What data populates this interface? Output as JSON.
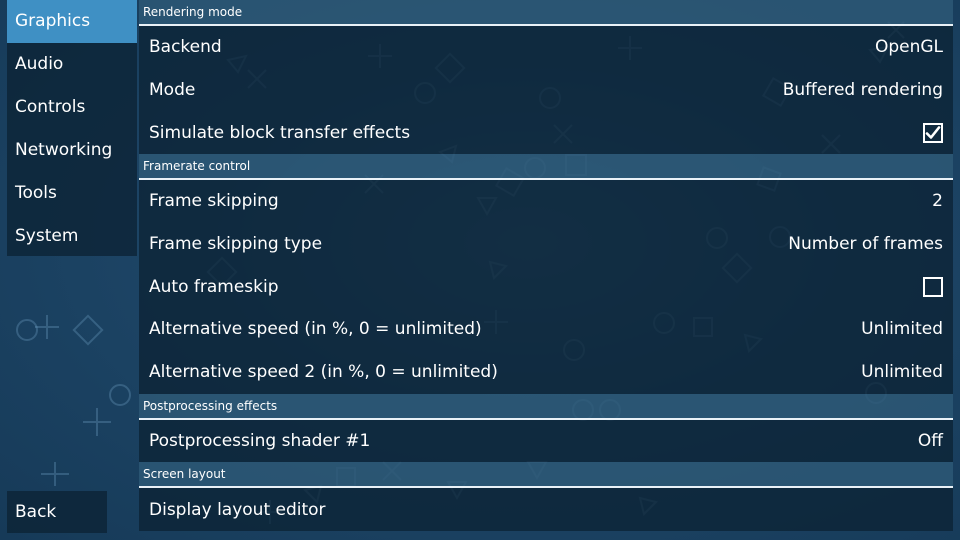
{
  "tabs": {
    "items": [
      {
        "label": "Graphics"
      },
      {
        "label": "Audio"
      },
      {
        "label": "Controls"
      },
      {
        "label": "Networking"
      },
      {
        "label": "Tools"
      },
      {
        "label": "System"
      }
    ],
    "active": "Graphics",
    "back_label": "Back"
  },
  "sections": {
    "rendering_mode": {
      "header": "Rendering mode",
      "backend": {
        "label": "Backend",
        "value": "OpenGL"
      },
      "mode": {
        "label": "Mode",
        "value": "Buffered rendering"
      },
      "block_transfer": {
        "label": "Simulate block transfer effects",
        "checked": true
      }
    },
    "framerate_control": {
      "header": "Framerate control",
      "frame_skipping": {
        "label": "Frame skipping",
        "value": "2"
      },
      "frame_skipping_type": {
        "label": "Frame skipping type",
        "value": "Number of frames"
      },
      "auto_frameskip": {
        "label": "Auto frameskip",
        "checked": false
      },
      "alt_speed": {
        "label": "Alternative speed (in %, 0 = unlimited)",
        "value": "Unlimited"
      },
      "alt_speed_2": {
        "label": "Alternative speed 2 (in %, 0 = unlimited)",
        "value": "Unlimited"
      }
    },
    "postprocessing": {
      "header": "Postprocessing effects",
      "shader1": {
        "label": "Postprocessing shader #1",
        "value": "Off"
      }
    },
    "screen_layout": {
      "header": "Screen layout",
      "layout_editor": {
        "label": "Display layout editor"
      }
    }
  },
  "colors": {
    "active_tab": "#3f90c4",
    "panel_bg": "#0c2234",
    "header_bg": "#2d5876",
    "background": "#1d4566"
  },
  "icons": {
    "checked": "checkmark-icon",
    "background_pattern": "playstation-symbols"
  }
}
